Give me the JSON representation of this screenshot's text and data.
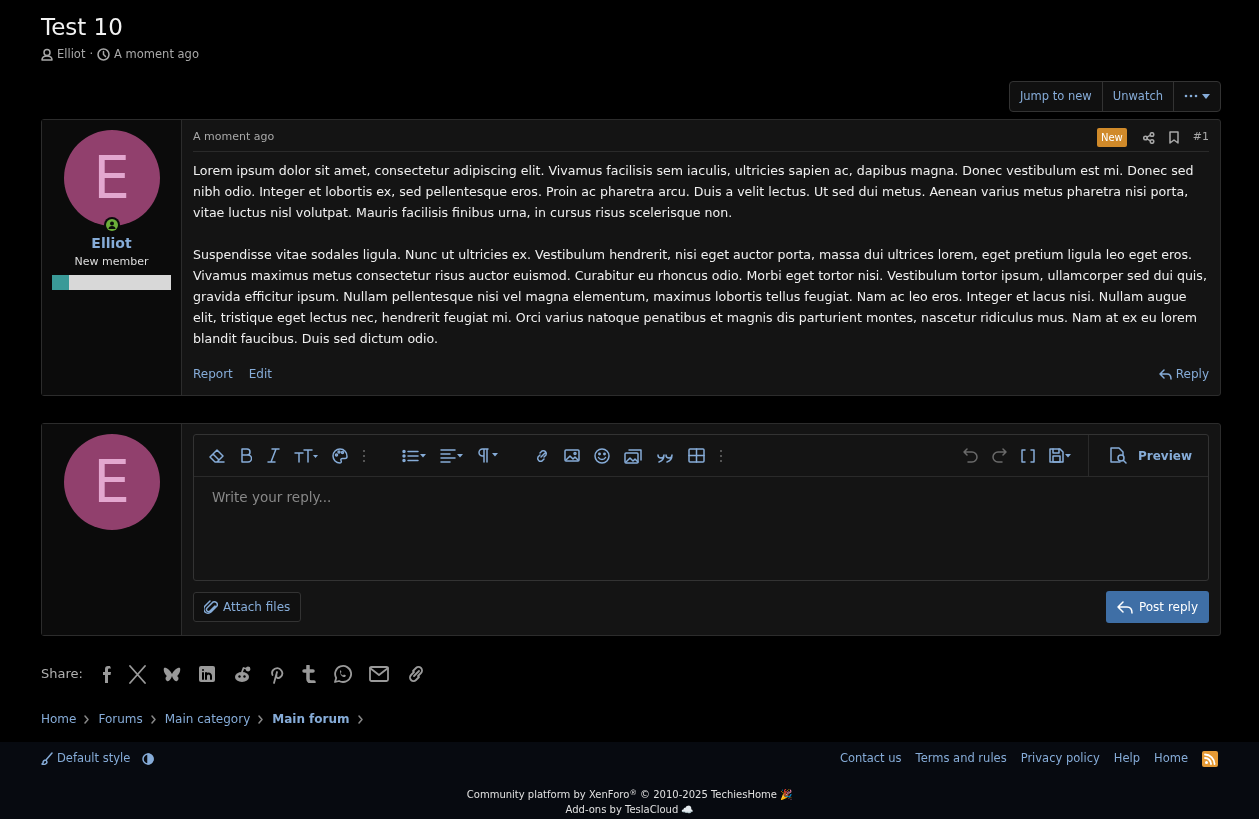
{
  "thread": {
    "title": "Test 10",
    "author": "Elliot",
    "separator": "·",
    "time": "A moment ago"
  },
  "thread_actions": [
    "Jump to new",
    "Unwatch"
  ],
  "post": {
    "time": "A moment ago",
    "badge": "New",
    "number": "#1",
    "author": {
      "initial": "E",
      "name": "Elliot",
      "title": "New member",
      "online": true,
      "level": 0.14
    },
    "paragraphs": [
      "Lorem ipsum dolor sit amet, consectetur adipiscing elit. Vivamus facilisis sem iaculis, ultricies sapien ac, dapibus magna. Donec vestibulum est mi. Donec sed nibh odio. Integer et lobortis ex, sed pellentesque eros. Proin ac pharetra arcu. Duis a velit lectus. Ut sed dui metus. Aenean varius metus pharetra nisi porta, vitae luctus nisl volutpat. Mauris facilisis finibus urna, in cursus risus scelerisque non.",
      "Suspendisse vitae sodales ligula. Nunc ut ultricies ex. Vestibulum hendrerit, nisi eget auctor porta, massa dui ultrices lorem, eget pretium ligula leo eget eros. Vivamus maximus metus consectetur risus auctor euismod. Curabitur eu rhoncus odio. Morbi eget tortor nisi. Vestibulum tortor ipsum, ullamcorper sed dui quis, gravida efficitur ipsum. Nullam pellentesque nisi vel magna elementum, maximus lobortis tellus feugiat. Nam ac leo eros. Integer et lacus nisi. Nullam augue elit, tristique eget lectus nec, hendrerit feugiat mi. Orci varius natoque penatibus et magnis dis parturient montes, nascetur ridiculus mus. Nam at ex eu lorem blandit faucibus. Duis sed dictum odio."
    ],
    "actions": [
      "Report",
      "Edit"
    ],
    "reply": "Reply"
  },
  "editor": {
    "initial": "E",
    "placeholder": "Write your reply...",
    "preview": "Preview",
    "attach": "Attach files",
    "submit": "Post reply"
  },
  "share": {
    "label": "Share:"
  },
  "breadcrumbs": [
    {
      "label": "Home",
      "current": false
    },
    {
      "label": "Forums",
      "current": false
    },
    {
      "label": "Main category",
      "current": false
    },
    {
      "label": "Main forum",
      "current": true
    }
  ],
  "footer": {
    "style": "Default style",
    "links": [
      "Contact us",
      "Terms and rules",
      "Privacy policy",
      "Help",
      "Home"
    ],
    "copyright": "Community platform by XenForo$^{®}$ © 2010-2025 TechiesHome 🎉",
    "addons": "Add-ons by TeslaCloud ☁️"
  }
}
